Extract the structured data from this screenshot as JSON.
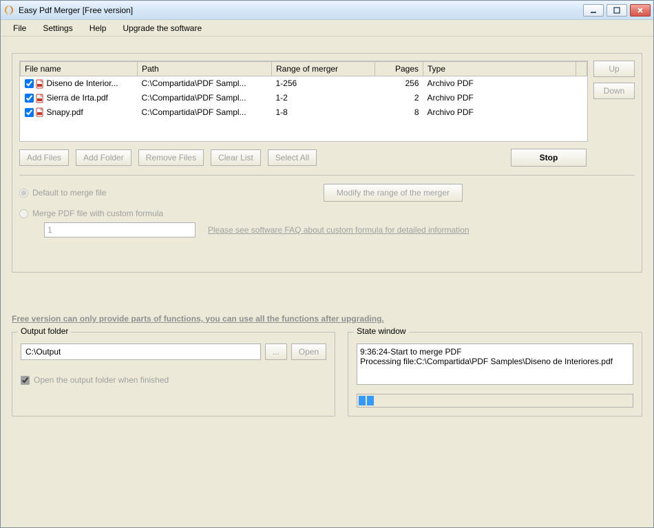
{
  "window": {
    "title": "Easy Pdf Merger [Free version]"
  },
  "menu": {
    "file": "File",
    "settings": "Settings",
    "help": "Help",
    "upgrade": "Upgrade the software"
  },
  "table": {
    "headers": {
      "filename": "File name",
      "path": "Path",
      "range": "Range of merger",
      "pages": "Pages",
      "type": "Type"
    },
    "rows": [
      {
        "checked": true,
        "filename": "Diseno de Interior...",
        "path": "C:\\Compartida\\PDF Sampl...",
        "range": "1-256",
        "pages": "256",
        "type": "Archivo PDF"
      },
      {
        "checked": true,
        "filename": "Sierra de Irta.pdf",
        "path": "C:\\Compartida\\PDF Sampl...",
        "range": "1-2",
        "pages": "2",
        "type": "Archivo PDF"
      },
      {
        "checked": true,
        "filename": "Snapy.pdf",
        "path": "C:\\Compartida\\PDF Sampl...",
        "range": "1-8",
        "pages": "8",
        "type": "Archivo PDF"
      }
    ]
  },
  "side": {
    "up": "Up",
    "down": "Down"
  },
  "actions": {
    "add_files": "Add Files",
    "add_folder": "Add Folder",
    "remove_files": "Remove Files",
    "clear_list": "Clear List",
    "select_all": "Select All",
    "stop": "Stop"
  },
  "merge": {
    "default_label": "Default to merge file",
    "modify_btn": "Modify the range of the merger",
    "custom_label": "Merge PDF file with custom formula",
    "formula_value": "1",
    "faq": "Please see software FAQ about custom formula for detailed information"
  },
  "upgrade_note": "Free version can only provide parts of functions, you can use all the functions after upgrading.",
  "output": {
    "legend": "Output folder",
    "path": "C:\\Output",
    "browse": "...",
    "open": "Open",
    "open_when_finished": "Open the output folder when finished"
  },
  "state": {
    "legend": "State window",
    "log": "9:36:24-Start to merge PDF\nProcessing file:C:\\Compartida\\PDF Samples\\Diseno de Interiores.pdf"
  }
}
